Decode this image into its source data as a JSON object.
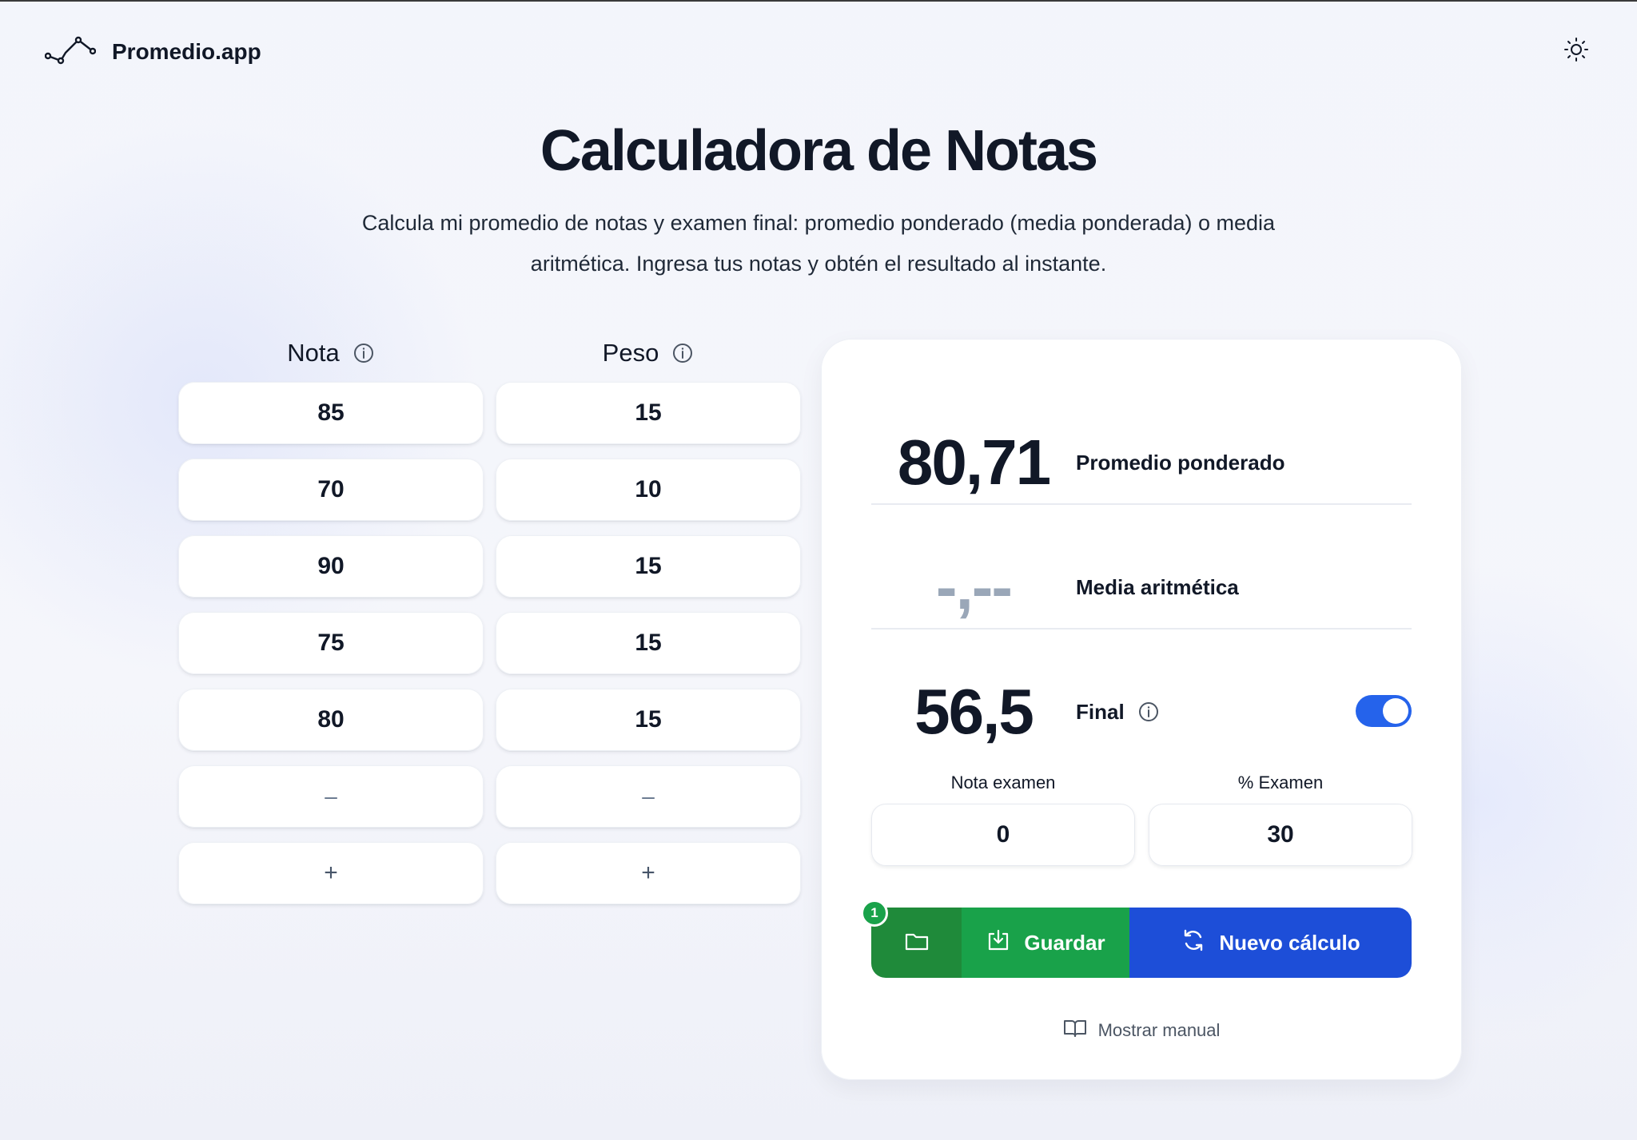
{
  "header": {
    "brand_name": "Promedio.app",
    "logo_icon": "line-chart-icon",
    "theme_icon": "sun-icon"
  },
  "hero": {
    "title": "Calculadora de Notas",
    "subtitle": "Calcula mi promedio de notas y examen final: promedio ponderado (media ponderada) o media aritmética. Ingresa tus notas y obtén el resultado al instante."
  },
  "grades": {
    "nota_header": "Nota",
    "peso_header": "Peso",
    "rows": [
      {
        "nota": "85",
        "peso": "15"
      },
      {
        "nota": "70",
        "peso": "10"
      },
      {
        "nota": "90",
        "peso": "15"
      },
      {
        "nota": "75",
        "peso": "15"
      },
      {
        "nota": "80",
        "peso": "15"
      }
    ],
    "empty_placeholder": "–",
    "add_label": "+"
  },
  "results": {
    "weighted_value": "80,71",
    "weighted_label": "Promedio ponderado",
    "arith_value": "-,--",
    "arith_label": "Media aritmética",
    "final_value": "56,5",
    "final_label": "Final",
    "final_toggle_on": true,
    "exam_grade_label": "Nota examen",
    "exam_grade_value": "0",
    "exam_pct_label": "% Examen",
    "exam_pct_value": "30",
    "saved_badge": "1",
    "save_label": "Guardar",
    "new_label": "Nuevo cálculo",
    "manual_label": "Mostrar manual"
  },
  "colors": {
    "accent_blue": "#1d4ed8",
    "toggle_blue": "#2563eb",
    "save_green": "#19a24a",
    "folder_green": "#1f8a3a"
  }
}
